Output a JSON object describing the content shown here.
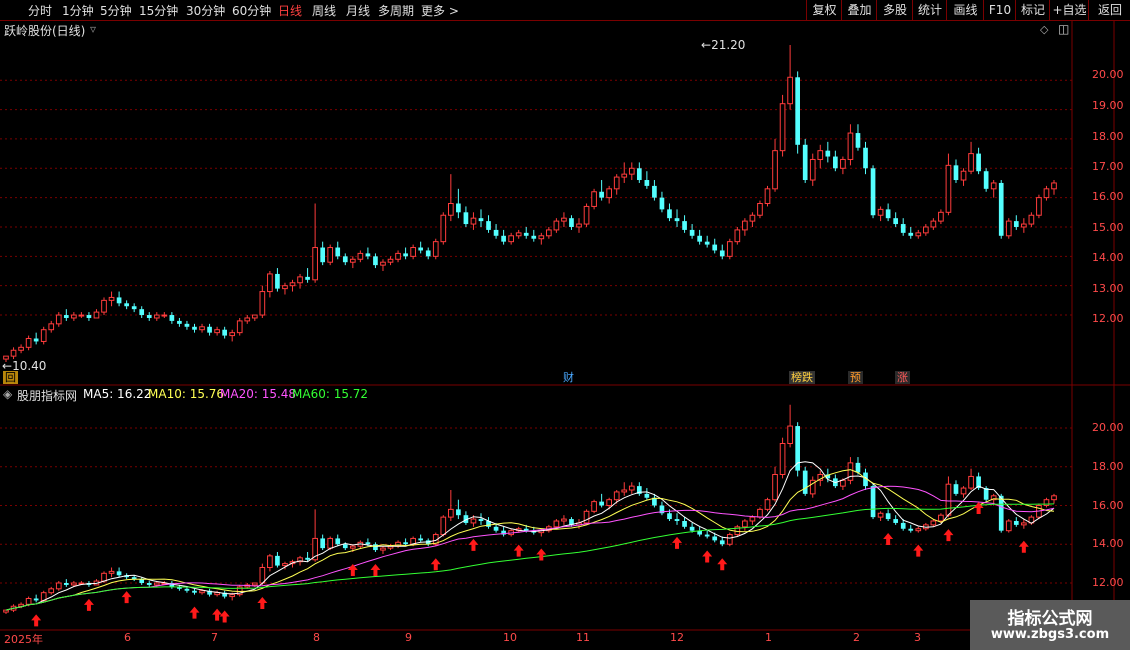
{
  "toolbar": {
    "timeframes": [
      "分时",
      "1分钟",
      "5分钟",
      "15分钟",
      "30分钟",
      "60分钟",
      "日线",
      "周线",
      "月线",
      "多周期",
      "更多 >"
    ],
    "active": "日线",
    "right_buttons": [
      "复权",
      "叠加",
      "多股",
      "统计",
      "画线",
      "F10",
      "标记",
      "+自选",
      "返回"
    ]
  },
  "main_panel": {
    "title": "跃岭股份(日线)",
    "high_label": "21.20",
    "low_label": "10.40",
    "y_labels": [
      "20.00",
      "19.00",
      "18.00",
      "17.00",
      "16.00",
      "15.00",
      "14.00",
      "13.00",
      "12.00"
    ],
    "badges": {
      "cai": "财",
      "bang": "榜跌",
      "yu": "预",
      "zhang": "涨"
    },
    "marker_char": "回"
  },
  "indicator_panel": {
    "name": "股朋指标网",
    "ma5": "MA5: 16.22",
    "ma10": "MA10: 15.76",
    "ma20": "MA20: 15.48",
    "ma60": "MA60: 15.72",
    "y_labels": [
      "20.00",
      "18.00",
      "16.00",
      "14.00",
      "12.00"
    ]
  },
  "x_axis": [
    "2025年",
    "6",
    "7",
    "8",
    "9",
    "10",
    "11",
    "12",
    "1",
    "2",
    "3"
  ],
  "watermark": {
    "line1": "指标公式网",
    "line2": "www.zbgs3.com"
  },
  "colors": {
    "up": "#ff3c3c",
    "down": "#54ffff",
    "ma5": "#ffffff",
    "ma10": "#ffff54",
    "ma20": "#ff54ff",
    "ma60": "#33ff33",
    "grid": "#7a0000"
  },
  "chart_data": {
    "type": "candlestick",
    "y_range_main": [
      10.4,
      21.2
    ],
    "y_range_indicator": [
      11.0,
      21.5
    ],
    "values": [
      [
        10.5,
        10.6,
        10.4,
        10.6
      ],
      [
        10.6,
        10.9,
        10.5,
        10.8
      ],
      [
        10.8,
        11.0,
        10.7,
        10.9
      ],
      [
        10.9,
        11.3,
        10.8,
        11.2
      ],
      [
        11.2,
        11.4,
        11.0,
        11.1
      ],
      [
        11.1,
        11.6,
        11.0,
        11.5
      ],
      [
        11.5,
        11.8,
        11.4,
        11.7
      ],
      [
        11.7,
        12.1,
        11.6,
        12.0
      ],
      [
        12.0,
        12.2,
        11.8,
        11.9
      ],
      [
        11.9,
        12.1,
        11.8,
        12.0
      ],
      [
        12.0,
        12.1,
        11.9,
        12.0
      ],
      [
        12.0,
        12.1,
        11.8,
        11.9
      ],
      [
        11.9,
        12.2,
        11.9,
        12.1
      ],
      [
        12.1,
        12.6,
        12.0,
        12.5
      ],
      [
        12.5,
        12.8,
        12.3,
        12.6
      ],
      [
        12.6,
        12.8,
        12.3,
        12.4
      ],
      [
        12.4,
        12.5,
        12.2,
        12.3
      ],
      [
        12.3,
        12.4,
        12.1,
        12.2
      ],
      [
        12.2,
        12.3,
        11.9,
        12.0
      ],
      [
        12.0,
        12.1,
        11.8,
        11.9
      ],
      [
        11.9,
        12.1,
        11.8,
        12.0
      ],
      [
        12.0,
        12.1,
        11.9,
        12.0
      ],
      [
        12.0,
        12.1,
        11.7,
        11.8
      ],
      [
        11.8,
        11.9,
        11.6,
        11.7
      ],
      [
        11.7,
        11.8,
        11.5,
        11.6
      ],
      [
        11.6,
        11.7,
        11.4,
        11.5
      ],
      [
        11.5,
        11.7,
        11.4,
        11.6
      ],
      [
        11.6,
        11.7,
        11.3,
        11.4
      ],
      [
        11.4,
        11.6,
        11.3,
        11.5
      ],
      [
        11.5,
        11.6,
        11.2,
        11.3
      ],
      [
        11.3,
        11.5,
        11.1,
        11.4
      ],
      [
        11.4,
        11.9,
        11.3,
        11.8
      ],
      [
        11.8,
        12.0,
        11.7,
        11.9
      ],
      [
        11.9,
        12.0,
        11.8,
        12.0
      ],
      [
        12.0,
        13.0,
        11.9,
        12.8
      ],
      [
        12.8,
        13.5,
        12.6,
        13.4
      ],
      [
        13.4,
        13.6,
        12.8,
        12.9
      ],
      [
        12.9,
        13.1,
        12.7,
        13.0
      ],
      [
        13.0,
        13.2,
        12.8,
        13.1
      ],
      [
        13.1,
        13.4,
        12.9,
        13.3
      ],
      [
        13.3,
        13.6,
        13.1,
        13.2
      ],
      [
        13.2,
        15.8,
        13.1,
        14.3
      ],
      [
        14.3,
        14.5,
        13.7,
        13.8
      ],
      [
        13.8,
        14.4,
        13.7,
        14.3
      ],
      [
        14.3,
        14.5,
        13.9,
        14.0
      ],
      [
        14.0,
        14.1,
        13.7,
        13.8
      ],
      [
        13.8,
        14.0,
        13.6,
        13.9
      ],
      [
        13.9,
        14.2,
        13.8,
        14.1
      ],
      [
        14.1,
        14.3,
        13.9,
        14.0
      ],
      [
        14.0,
        14.1,
        13.6,
        13.7
      ],
      [
        13.7,
        13.9,
        13.5,
        13.8
      ],
      [
        13.8,
        14.0,
        13.7,
        13.9
      ],
      [
        13.9,
        14.2,
        13.8,
        14.1
      ],
      [
        14.1,
        14.3,
        13.9,
        14.0
      ],
      [
        14.0,
        14.4,
        13.9,
        14.3
      ],
      [
        14.3,
        14.5,
        14.1,
        14.2
      ],
      [
        14.2,
        14.3,
        13.9,
        14.0
      ],
      [
        14.0,
        14.6,
        13.9,
        14.5
      ],
      [
        14.5,
        15.5,
        14.4,
        15.4
      ],
      [
        15.4,
        16.8,
        15.2,
        15.8
      ],
      [
        15.8,
        16.3,
        15.3,
        15.5
      ],
      [
        15.5,
        15.7,
        15.0,
        15.1
      ],
      [
        15.1,
        15.5,
        14.9,
        15.3
      ],
      [
        15.3,
        15.6,
        15.0,
        15.2
      ],
      [
        15.2,
        15.4,
        14.8,
        14.9
      ],
      [
        14.9,
        15.1,
        14.6,
        14.7
      ],
      [
        14.7,
        14.9,
        14.4,
        14.5
      ],
      [
        14.5,
        14.8,
        14.4,
        14.7
      ],
      [
        14.7,
        14.9,
        14.6,
        14.8
      ],
      [
        14.8,
        15.0,
        14.6,
        14.7
      ],
      [
        14.7,
        14.9,
        14.5,
        14.6
      ],
      [
        14.6,
        14.8,
        14.4,
        14.7
      ],
      [
        14.7,
        15.0,
        14.6,
        14.9
      ],
      [
        14.9,
        15.3,
        14.8,
        15.2
      ],
      [
        15.2,
        15.5,
        15.0,
        15.3
      ],
      [
        15.3,
        15.4,
        14.9,
        15.0
      ],
      [
        15.0,
        15.3,
        14.8,
        15.1
      ],
      [
        15.1,
        15.8,
        15.0,
        15.7
      ],
      [
        15.7,
        16.3,
        15.6,
        16.2
      ],
      [
        16.2,
        16.6,
        15.9,
        16.0
      ],
      [
        16.0,
        16.4,
        15.8,
        16.3
      ],
      [
        16.3,
        16.8,
        16.1,
        16.7
      ],
      [
        16.7,
        17.2,
        16.5,
        16.8
      ],
      [
        16.8,
        17.2,
        16.6,
        17.0
      ],
      [
        17.0,
        17.2,
        16.5,
        16.6
      ],
      [
        16.6,
        16.9,
        16.3,
        16.4
      ],
      [
        16.4,
        16.6,
        15.9,
        16.0
      ],
      [
        16.0,
        16.2,
        15.5,
        15.6
      ],
      [
        15.6,
        15.8,
        15.2,
        15.3
      ],
      [
        15.3,
        15.6,
        15.0,
        15.2
      ],
      [
        15.2,
        15.4,
        14.8,
        14.9
      ],
      [
        14.9,
        15.1,
        14.6,
        14.7
      ],
      [
        14.7,
        14.9,
        14.4,
        14.5
      ],
      [
        14.5,
        14.7,
        14.3,
        14.4
      ],
      [
        14.4,
        14.6,
        14.1,
        14.2
      ],
      [
        14.2,
        14.4,
        13.9,
        14.0
      ],
      [
        14.0,
        14.6,
        13.9,
        14.5
      ],
      [
        14.5,
        15.0,
        14.4,
        14.9
      ],
      [
        14.9,
        15.3,
        14.7,
        15.2
      ],
      [
        15.2,
        15.5,
        15.0,
        15.4
      ],
      [
        15.4,
        15.9,
        15.3,
        15.8
      ],
      [
        15.8,
        16.4,
        15.7,
        16.3
      ],
      [
        16.3,
        18.0,
        16.2,
        17.6
      ],
      [
        17.6,
        19.5,
        17.4,
        19.2
      ],
      [
        19.2,
        21.2,
        19.0,
        20.1
      ],
      [
        20.1,
        20.3,
        17.5,
        17.8
      ],
      [
        17.8,
        18.0,
        16.5,
        16.6
      ],
      [
        16.6,
        17.5,
        16.4,
        17.3
      ],
      [
        17.3,
        17.8,
        17.0,
        17.6
      ],
      [
        17.6,
        17.9,
        17.2,
        17.4
      ],
      [
        17.4,
        17.6,
        16.9,
        17.0
      ],
      [
        17.0,
        17.4,
        16.8,
        17.3
      ],
      [
        17.3,
        18.5,
        17.1,
        18.2
      ],
      [
        18.2,
        18.5,
        17.6,
        17.7
      ],
      [
        17.7,
        17.9,
        16.8,
        17.0
      ],
      [
        17.0,
        17.1,
        15.3,
        15.4
      ],
      [
        15.4,
        15.7,
        15.2,
        15.6
      ],
      [
        15.6,
        15.8,
        15.2,
        15.3
      ],
      [
        15.3,
        15.5,
        15.0,
        15.1
      ],
      [
        15.1,
        15.3,
        14.7,
        14.8
      ],
      [
        14.8,
        15.0,
        14.6,
        14.7
      ],
      [
        14.7,
        14.9,
        14.6,
        14.8
      ],
      [
        14.8,
        15.1,
        14.7,
        15.0
      ],
      [
        15.0,
        15.3,
        14.9,
        15.2
      ],
      [
        15.2,
        15.6,
        15.1,
        15.5
      ],
      [
        15.5,
        17.5,
        15.4,
        17.1
      ],
      [
        17.1,
        17.3,
        16.5,
        16.6
      ],
      [
        16.6,
        17.0,
        16.4,
        16.9
      ],
      [
        16.9,
        17.9,
        16.8,
        17.5
      ],
      [
        17.5,
        17.7,
        16.8,
        16.9
      ],
      [
        16.9,
        17.0,
        16.2,
        16.3
      ],
      [
        16.3,
        16.6,
        16.0,
        16.5
      ],
      [
        16.5,
        16.6,
        14.6,
        14.7
      ],
      [
        14.7,
        15.3,
        14.6,
        15.2
      ],
      [
        15.2,
        15.4,
        14.9,
        15.0
      ],
      [
        15.0,
        15.3,
        14.8,
        15.1
      ],
      [
        15.1,
        15.5,
        15.0,
        15.4
      ],
      [
        15.4,
        16.1,
        15.3,
        16.0
      ],
      [
        16.0,
        16.4,
        15.9,
        16.3
      ],
      [
        16.3,
        16.6,
        16.1,
        16.5
      ]
    ],
    "ma_series": [
      {
        "name": "MA5",
        "last": 16.22
      },
      {
        "name": "MA10",
        "last": 15.76
      },
      {
        "name": "MA20",
        "last": 15.48
      },
      {
        "name": "MA60",
        "last": 15.72
      }
    ]
  }
}
